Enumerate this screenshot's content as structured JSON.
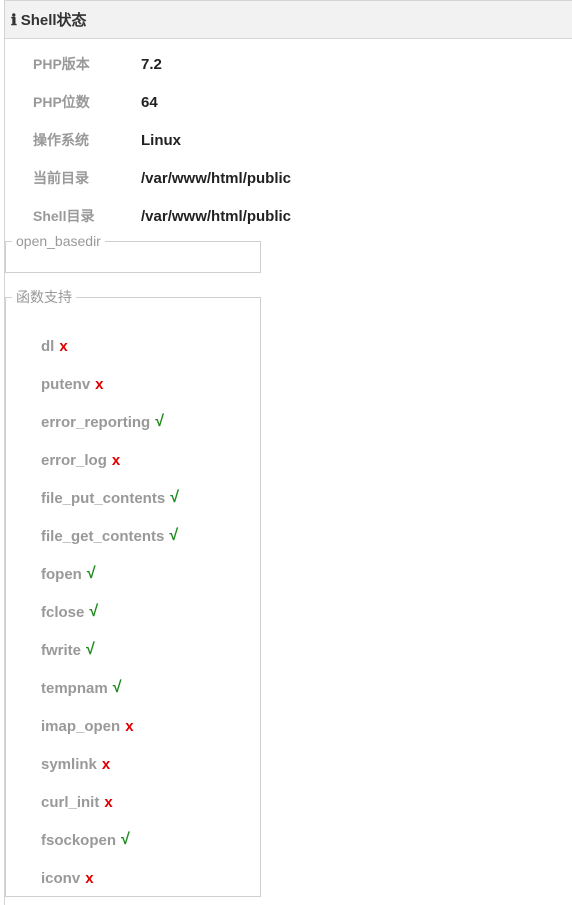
{
  "header": {
    "icon": "info-icon",
    "title": "Shell状态"
  },
  "info": [
    {
      "label": "PHP版本",
      "value": "7.2"
    },
    {
      "label": "PHP位数",
      "value": "64"
    },
    {
      "label": "操作系统",
      "value": "Linux"
    },
    {
      "label": "当前目录",
      "value": "/var/www/html/public"
    },
    {
      "label": "Shell目录",
      "value": "/var/www/html/public"
    }
  ],
  "basedir": {
    "legend": "open_basedir"
  },
  "functions": {
    "legend": "函数支持",
    "items": [
      {
        "name": "dl",
        "mark": "x",
        "supported": false
      },
      {
        "name": "putenv",
        "mark": "x",
        "supported": false
      },
      {
        "name": "error_reporting",
        "mark": "√",
        "supported": true
      },
      {
        "name": "error_log",
        "mark": "x",
        "supported": false
      },
      {
        "name": "file_put_contents",
        "mark": "√",
        "supported": true
      },
      {
        "name": "file_get_contents",
        "mark": "√",
        "supported": true
      },
      {
        "name": "fopen",
        "mark": "√",
        "supported": true
      },
      {
        "name": "fclose",
        "mark": "√",
        "supported": true
      },
      {
        "name": "fwrite",
        "mark": "√",
        "supported": true
      },
      {
        "name": "tempnam",
        "mark": "√",
        "supported": true
      },
      {
        "name": "imap_open",
        "mark": "x",
        "supported": false
      },
      {
        "name": "symlink",
        "mark": "x",
        "supported": false
      },
      {
        "name": "curl_init",
        "mark": "x",
        "supported": false
      },
      {
        "name": "fsockopen",
        "mark": "√",
        "supported": true
      },
      {
        "name": "iconv",
        "mark": "x",
        "supported": false
      }
    ]
  },
  "colors": {
    "supported": "#1a8a1a",
    "unsupported": "#e00000",
    "label": "#999999",
    "header_bg": "#f2f2f2"
  }
}
